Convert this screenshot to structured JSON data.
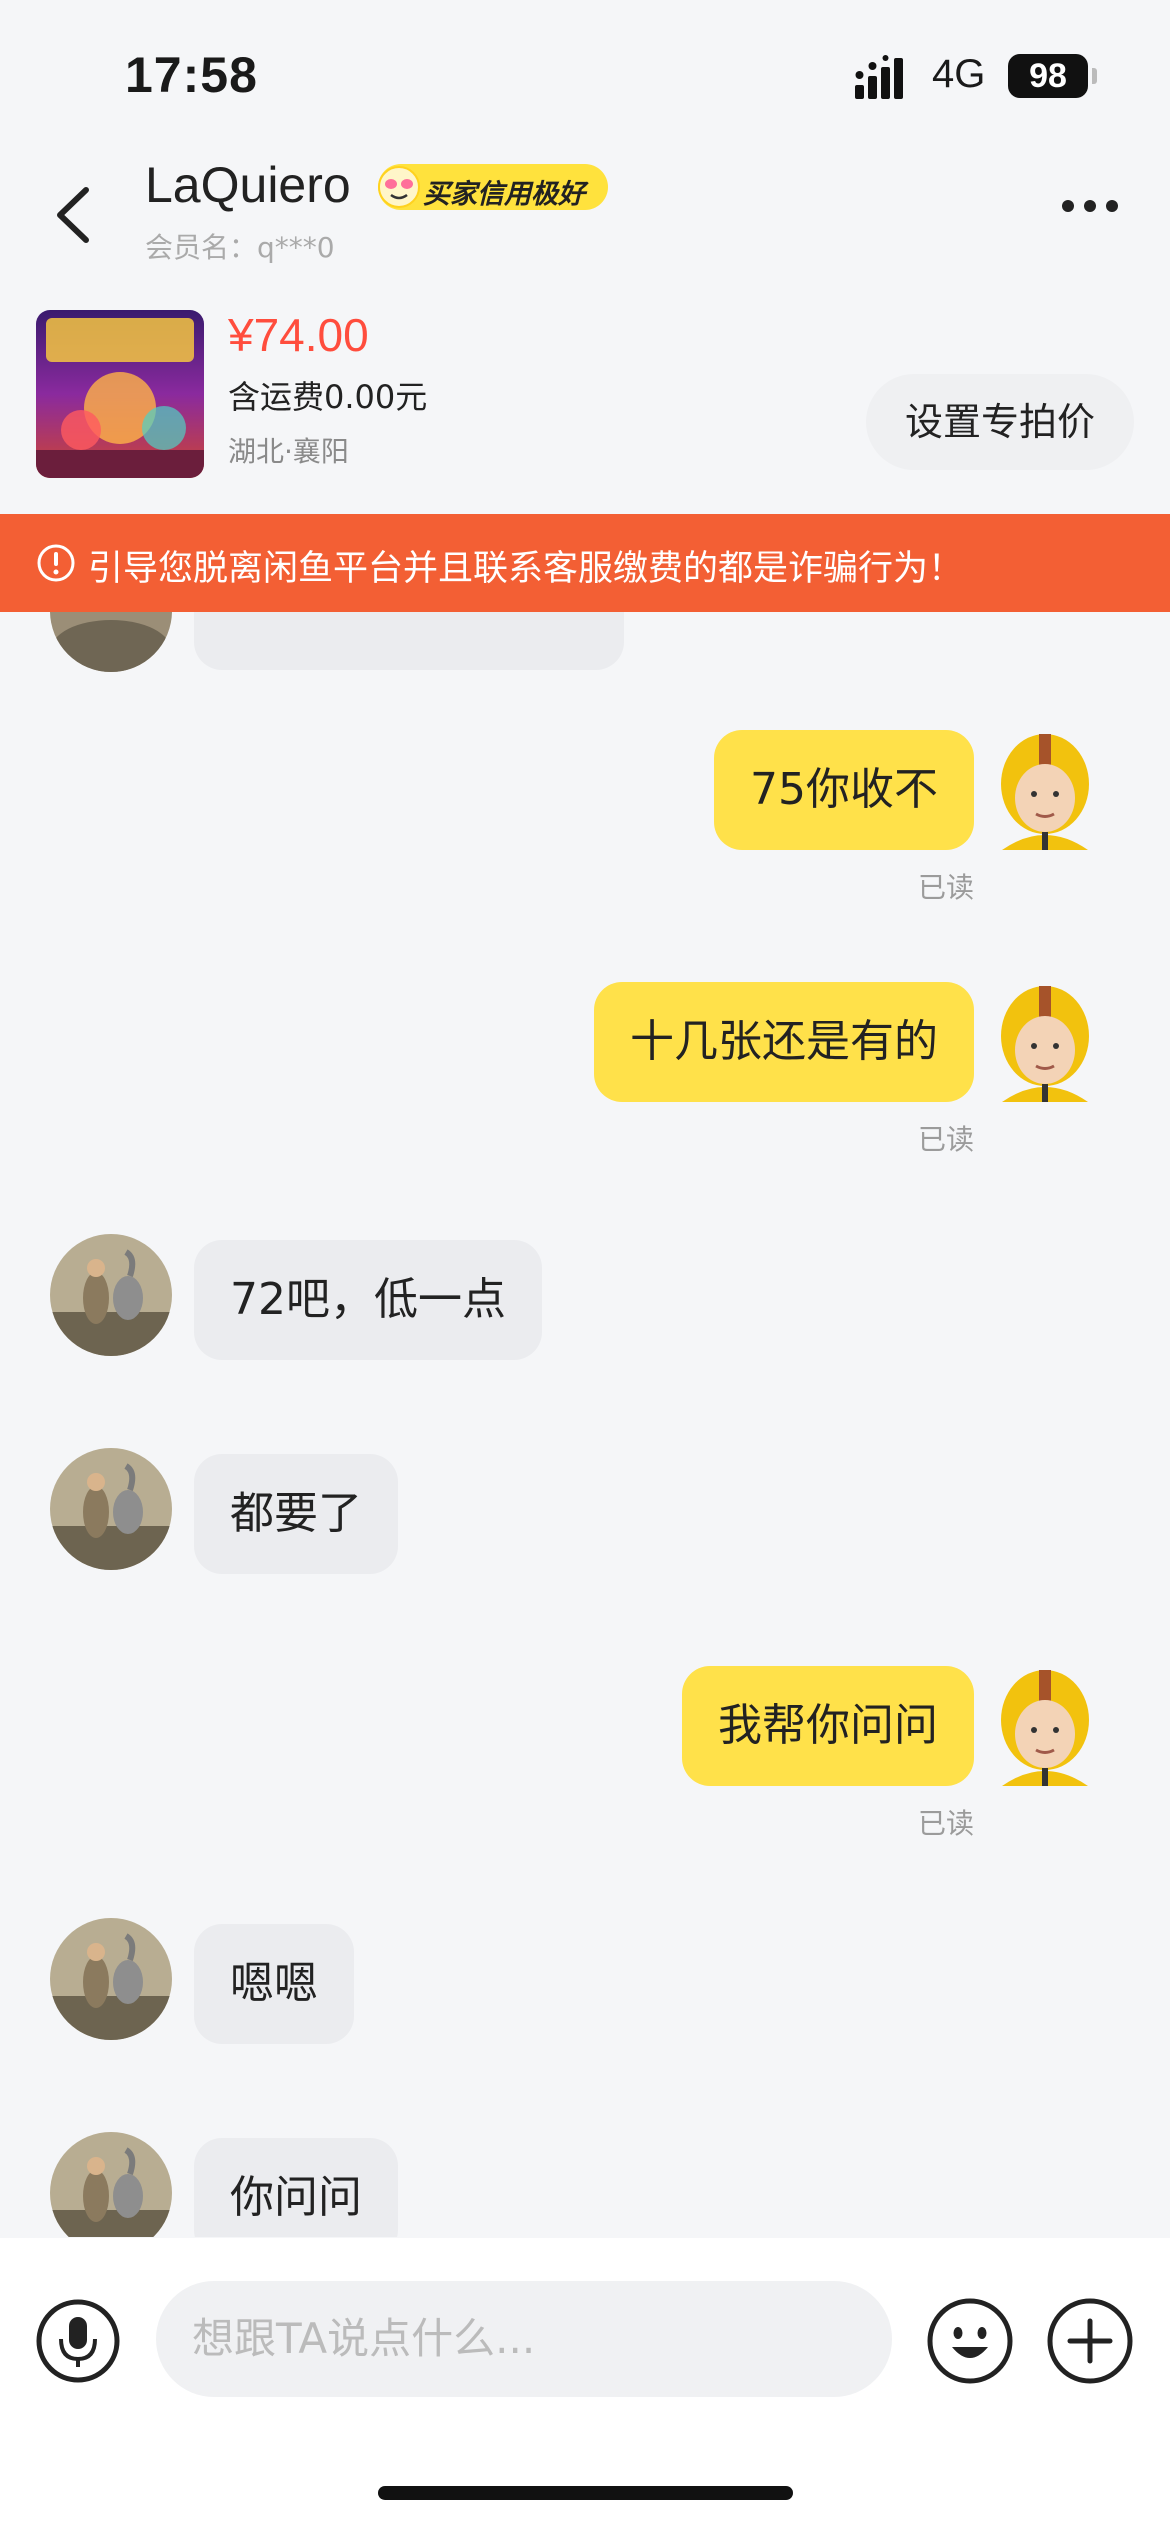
{
  "status_bar": {
    "time": "17:58",
    "network": "4G",
    "battery": "98"
  },
  "header": {
    "name": "LaQuiero",
    "credit_badge": "买家信用极好",
    "member_name": "会员名：q***0"
  },
  "product": {
    "price": "¥74.00",
    "shipping": "含运费0.00元",
    "location": "湖北·襄阳",
    "special_price_button": "设置专拍价"
  },
  "warning": {
    "text": "引导您脱离闲鱼平台并且联系客服缴费的都是诈骗行为！"
  },
  "messages": [
    {
      "sender": "me",
      "text": "75你收不",
      "status": "已读"
    },
    {
      "sender": "me",
      "text": "十几张还是有的",
      "status": "已读"
    },
    {
      "sender": "other",
      "text": "72吧，低一点"
    },
    {
      "sender": "other",
      "text": "都要了"
    },
    {
      "sender": "me",
      "text": "我帮你问问",
      "status": "已读"
    },
    {
      "sender": "other",
      "text": "嗯嗯"
    },
    {
      "sender": "other",
      "text": "你问问"
    }
  ],
  "input": {
    "placeholder": "想跟TA说点什么..."
  },
  "colors": {
    "accent_yellow": "#ffe14a",
    "warning_orange": "#f35f34",
    "price_red": "#ff4d3d"
  }
}
